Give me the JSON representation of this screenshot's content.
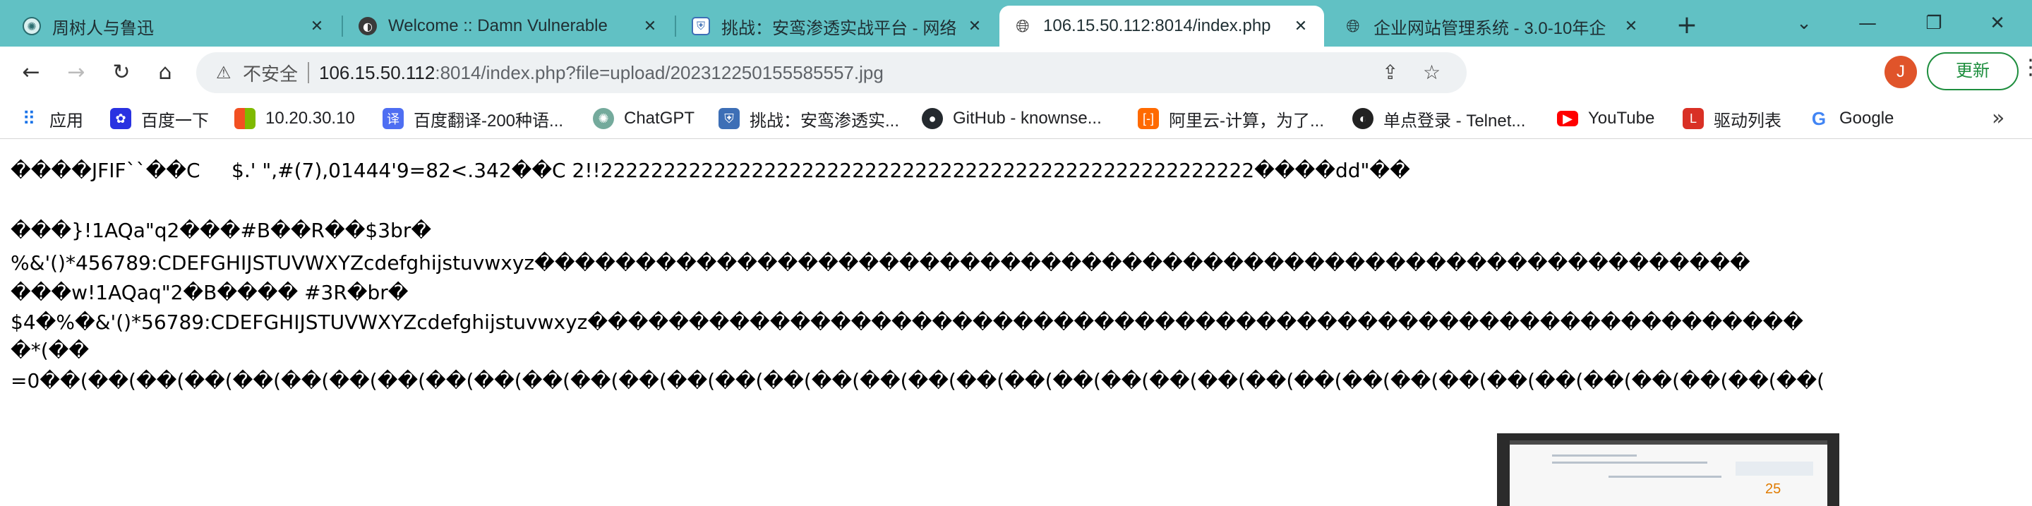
{
  "tabs": [
    {
      "title": "周树人与鲁迅",
      "icon": "chatgpt-icon",
      "active": false
    },
    {
      "title": "Welcome :: Damn Vulnerable",
      "icon": "dvwa-icon",
      "active": false
    },
    {
      "title": "挑战：安鸾渗透实战平台 - 网络",
      "icon": "shield-icon",
      "active": false
    },
    {
      "title": "106.15.50.112:8014/index.php",
      "icon": "globe-icon",
      "active": true
    },
    {
      "title": "企业网站管理系统 - 3.0-10年企",
      "icon": "globe-icon",
      "active": false
    }
  ],
  "toolbar": {
    "insecure_label": "不安全",
    "url_host": "106.15.50.112",
    "url_rest": ":8014/index.php?file=upload/202312250155585557.jpg",
    "profile_initial": "J",
    "update_label": "更新"
  },
  "bookmarks": [
    {
      "label": "应用",
      "icon": "apps-grid-icon",
      "color": "#1a73e8"
    },
    {
      "label": "百度一下",
      "icon": "baidu-paw-icon",
      "color": "#2932e1"
    },
    {
      "label": "10.20.30.10",
      "icon": "windows-logo-icon",
      "color": "#f25022"
    },
    {
      "label": "百度翻译-200种语...",
      "icon": "baidu-translate-icon",
      "color": "#4e6ef2"
    },
    {
      "label": "ChatGPT",
      "icon": "chatgpt-icon",
      "color": "#74aa9c"
    },
    {
      "label": "挑战：安鸾渗透实...",
      "icon": "shield-icon",
      "color": "#3d6fb6"
    },
    {
      "label": "GitHub - knownse...",
      "icon": "github-icon",
      "color": "#24292e"
    },
    {
      "label": "阿里云-计算，为了...",
      "icon": "aliyun-icon",
      "color": "#ff6a00"
    },
    {
      "label": "单点登录 - Telnet...",
      "icon": "telnet-icon",
      "color": "#222222"
    },
    {
      "label": "YouTube",
      "icon": "youtube-icon",
      "color": "#ff0000"
    },
    {
      "label": "驱动列表",
      "icon": "driver-list-icon",
      "color": "#d93025"
    },
    {
      "label": "Google",
      "icon": "google-icon",
      "color": "#4285f4"
    }
  ],
  "page": {
    "lines": [
      "����JFIF``��C     $.' \",#(7),01444'9=82<.342��C 2!!2222222222222222222222222222222222222222222222222222����dd\"��",
      "���}!1AQa\"q2���#B��R��$3br�",
      "%&'()*456789:CDEFGHIJSTUVWXYZcdefghijstuvwxyz������������������������������������������������������������",
      "���w!1AQaq\"2�B���� #3R�br�",
      "$4�%�&'()*56789:CDEFGHIJSTUVWXYZcdefghijstuvwxyz������������������������������������������������������������",
      "�*(��",
      "=0��(��(��(��(��(��(��(��(��(��(��(��(��(��(��(��(��(��(��(��(��(��(��(��(��(��(��(��(��(��(��(��(��(��(��(��(��("
    ],
    "thumb_number": "25"
  },
  "colors": {
    "tabstrip": "#61c1c4",
    "update_green": "#1e8e3e",
    "profile": "#e0542a"
  }
}
